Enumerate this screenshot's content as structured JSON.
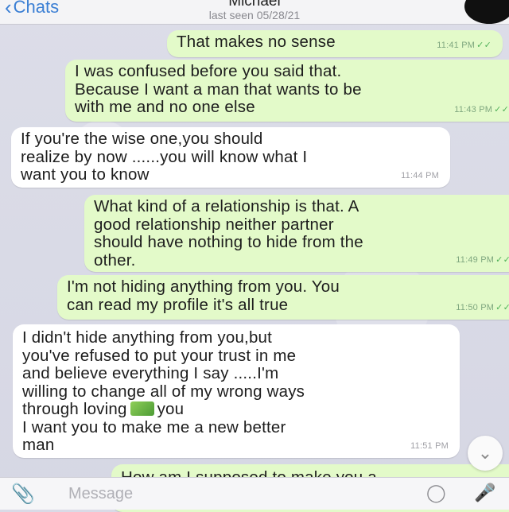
{
  "header": {
    "back_label": "Chats",
    "contact_name": "Michael",
    "status": "last seen 05/28/21"
  },
  "messages": [
    {
      "direction": "out",
      "lines": [
        "That makes no sense"
      ],
      "time": "11:41 PM"
    },
    {
      "direction": "out",
      "lines": [
        "I was confused before you said that.",
        "Because I want a man that wants to be",
        "with me and no one else"
      ],
      "time": "11:43 PM"
    },
    {
      "direction": "in",
      "lines": [
        "If you're the wise one,you should",
        "realize by now ......you will know what I",
        "want you to know"
      ],
      "time": "11:44 PM"
    },
    {
      "direction": "out",
      "lines": [
        "What kind of a relationship is that. A",
        "good relationship neither partner",
        "should have nothing to hide from the",
        "other."
      ],
      "time": "11:49 PM"
    },
    {
      "direction": "out",
      "lines": [
        "I'm not hiding anything from you. You",
        "can read my profile it's all true"
      ],
      "time": "11:50 PM"
    },
    {
      "direction": "in",
      "lines": [
        "I didn't hide anything from you,but",
        "you've refused to put your trust in me",
        "and believe everything I say .....I'm",
        "willing to change all of my wrong ways",
        "through loving",
        "you",
        "I want you to make me a new better",
        "man"
      ],
      "time": "11:51 PM"
    },
    {
      "direction": "out",
      "lines": [
        "How am I supposed to make you a"
      ],
      "time": ""
    }
  ],
  "input": {
    "placeholder": "Message"
  },
  "icons": {
    "back": "chevron-left-icon",
    "attach": "paperclip-icon",
    "sticker": "sticker-icon",
    "mic": "microphone-icon",
    "scroll": "chevron-down-icon",
    "check": "double-check-icon"
  },
  "colors": {
    "outgoing_bubble": "#e3fac9",
    "incoming_bubble": "#ffffff",
    "accent": "#3b7fd4",
    "read_check": "#52b15a"
  }
}
